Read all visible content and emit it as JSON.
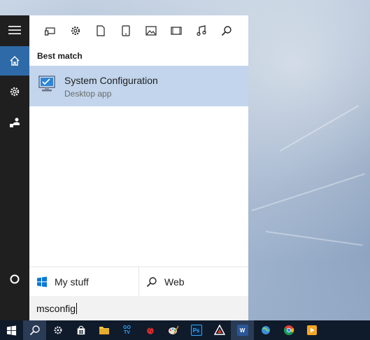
{
  "rail": {
    "items": [
      {
        "name": "hamburger-menu",
        "icon": "menu-icon"
      },
      {
        "name": "home",
        "icon": "home-icon",
        "active": true
      },
      {
        "name": "settings",
        "icon": "gear-icon"
      },
      {
        "name": "feedback",
        "icon": "feedback-icon"
      },
      {
        "name": "cortana",
        "icon": "circle-icon"
      }
    ]
  },
  "filters": [
    {
      "icon": "apps-icon"
    },
    {
      "icon": "settings-icon"
    },
    {
      "icon": "documents-icon"
    },
    {
      "icon": "tablet-icon"
    },
    {
      "icon": "photos-icon"
    },
    {
      "icon": "videos-icon"
    },
    {
      "icon": "music-icon"
    },
    {
      "icon": "web-search-icon"
    }
  ],
  "results": {
    "section_title": "Best match",
    "best_match": {
      "title": "System Configuration",
      "subtitle": "Desktop app",
      "icon": "system-configuration-icon"
    }
  },
  "scopes": {
    "my_stuff": "My stuff",
    "web": "Web"
  },
  "search": {
    "value": "msconfig"
  },
  "taskbar": {
    "items": [
      {
        "icon": "windows-start-icon"
      },
      {
        "icon": "search-icon",
        "active": true
      },
      {
        "icon": "gear-icon"
      },
      {
        "icon": "store-icon"
      },
      {
        "icon": "file-explorer-icon"
      },
      {
        "icon": "gotv-icon",
        "label": "GO TV"
      },
      {
        "icon": "ladybug-icon"
      },
      {
        "icon": "paint-icon"
      },
      {
        "icon": "photoshop-icon",
        "label": "Ps"
      },
      {
        "icon": "app-icon"
      },
      {
        "icon": "word-icon",
        "label": "W"
      },
      {
        "icon": "globe-icon"
      },
      {
        "icon": "chrome-icon"
      },
      {
        "icon": "media-player-icon"
      }
    ]
  },
  "colors": {
    "accent": "#2e6aa8",
    "result_highlight": "#c2d5ec",
    "rail_bg": "#1f1f1f",
    "taskbar_bg": "#0f1a2a"
  }
}
